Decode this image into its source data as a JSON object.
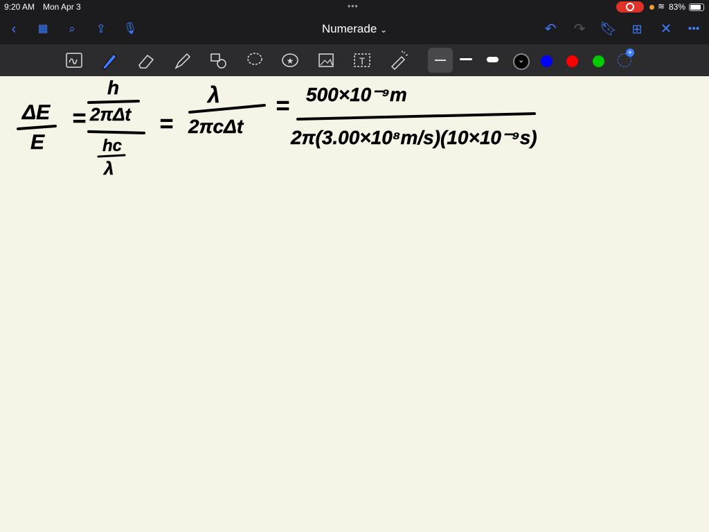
{
  "status": {
    "time": "9:20 AM",
    "date": "Mon Apr 3",
    "battery": "83%",
    "battery_level": 0.83
  },
  "nav": {
    "title": "Numerade",
    "title_chevron": "⌄"
  },
  "toolbar": {
    "colors": [
      "#000000",
      "#0000ff",
      "#ff0000",
      "#00cc00"
    ]
  },
  "note": {
    "line1": {
      "lhs_num": "ΔE",
      "lhs_den": "E",
      "eq1": "=",
      "f1_top": "h",
      "f1_mid": "2πΔt",
      "f1_bot_num": "hc",
      "f1_bot_den": "λ",
      "eq2": "=",
      "f2_num": "λ",
      "f2_den": "2πcΔt",
      "eq3": "=",
      "f3_num": "500×10⁻⁹m",
      "f3_den": "2π(3.00×10⁸m/s)(10×10⁻⁹s)"
    }
  }
}
